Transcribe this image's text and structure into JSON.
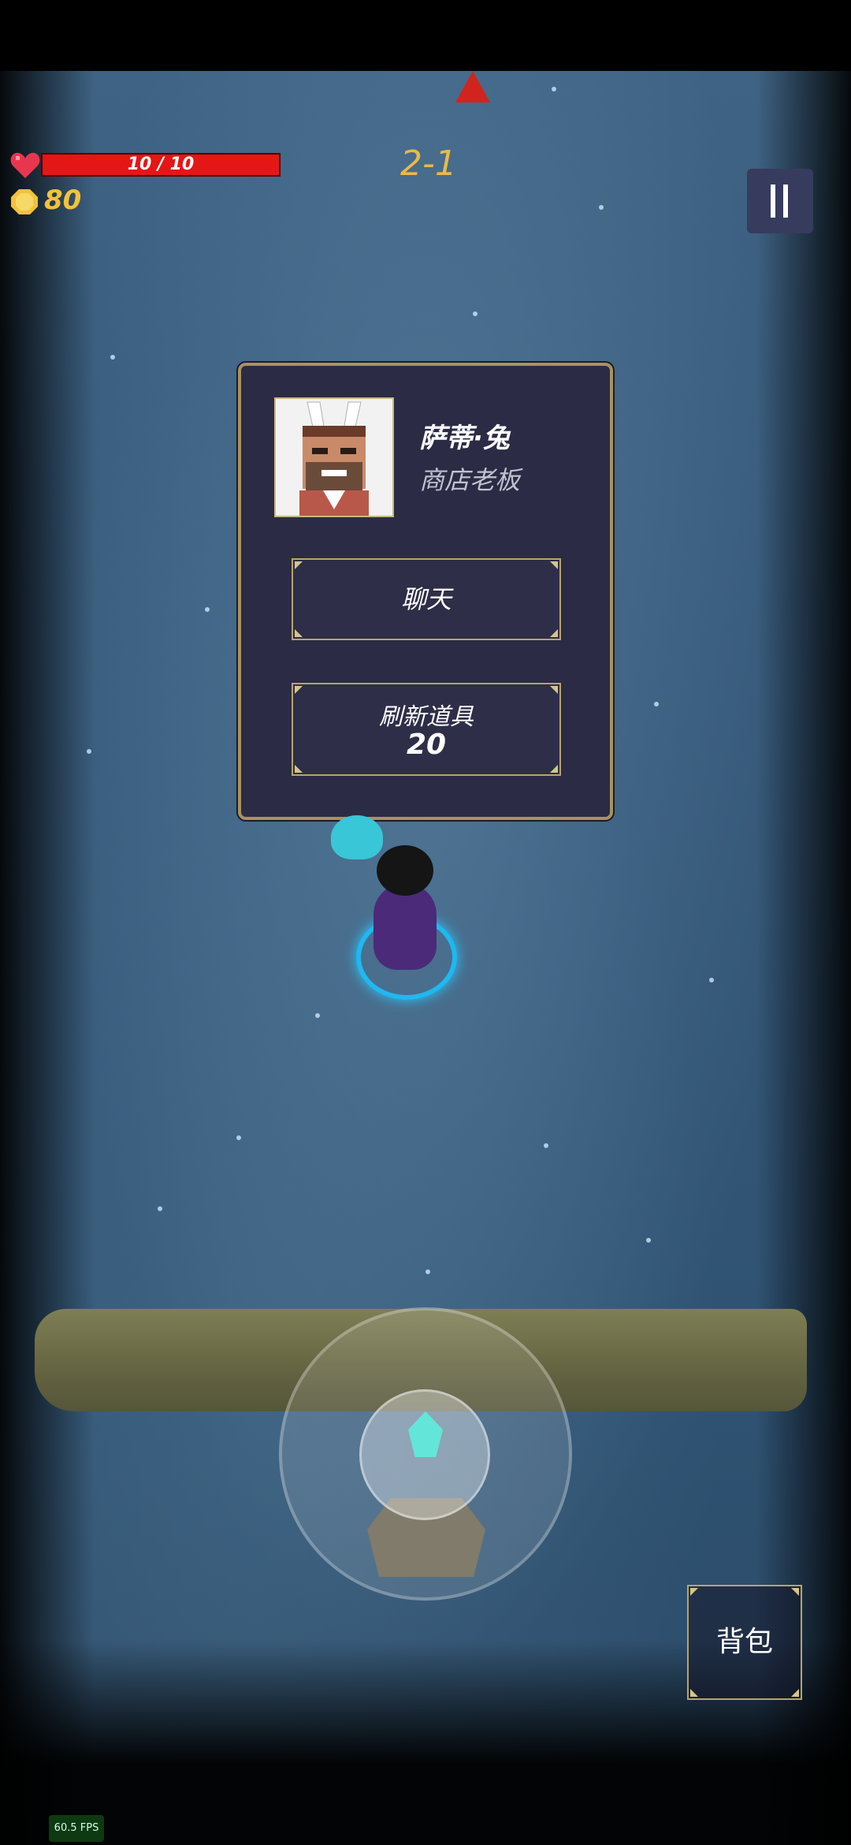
{
  "hud": {
    "health": "10 / 10",
    "health_fraction": 1.0,
    "coins": "80",
    "stage": "2-1",
    "pause_icon": "pause-icon"
  },
  "npc_dialog": {
    "name": "萨蒂·兔",
    "role": "商店老板",
    "portrait_icon": "bearded-bunny-ears-portrait",
    "chat_label": "聊天",
    "refresh_label": "刷新道具",
    "refresh_cost": "20"
  },
  "inventory": {
    "bag_label": "背包"
  },
  "debug": {
    "fps": "60.5 FPS"
  },
  "colors": {
    "accent_gold": "#b8a46b",
    "health_red": "#e51616",
    "coin_yellow": "#f2c23a",
    "stage_text": "#e9b949",
    "panel_bg": "#2b2b45",
    "ring_cyan": "#1fb8f0"
  }
}
